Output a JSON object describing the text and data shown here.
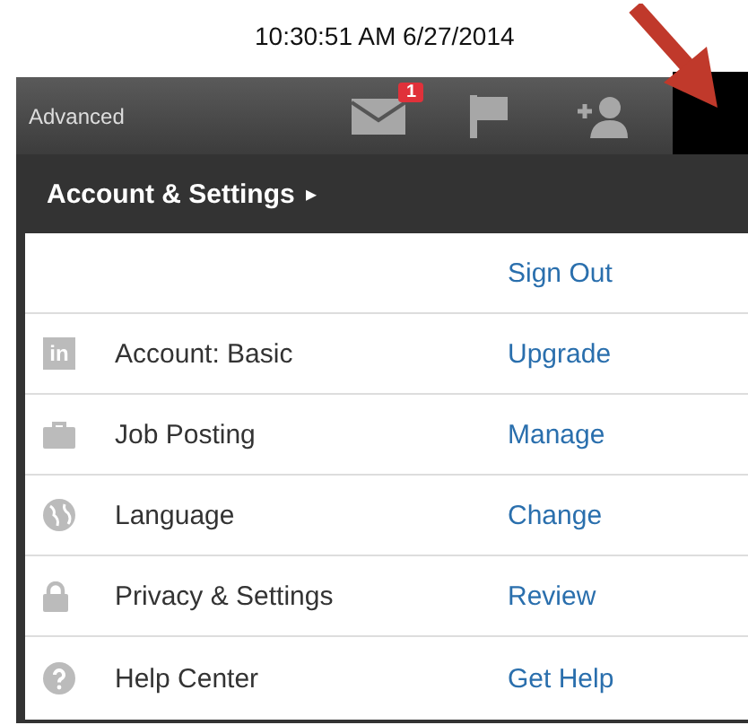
{
  "timestamp": "10:30:51 AM 6/27/2014",
  "top_bar": {
    "label": "Advanced",
    "icons": [
      {
        "kind": "mail",
        "badge": "1"
      },
      {
        "kind": "flag"
      },
      {
        "kind": "add-person"
      }
    ]
  },
  "menu": {
    "title": "Account & Settings",
    "arrow": "▸",
    "sign_out": "Sign Out",
    "rows": [
      {
        "kind": "linkedin",
        "icon_text": "in",
        "label": "Account: Basic",
        "action": "Upgrade"
      },
      {
        "kind": "briefcase",
        "label": "Job Posting",
        "action": "Manage"
      },
      {
        "kind": "globe",
        "label": "Language",
        "action": "Change"
      },
      {
        "kind": "lock",
        "label": "Privacy & Settings",
        "action": "Review"
      },
      {
        "kind": "help",
        "label": "Help Center",
        "action": "Get Help"
      }
    ]
  }
}
